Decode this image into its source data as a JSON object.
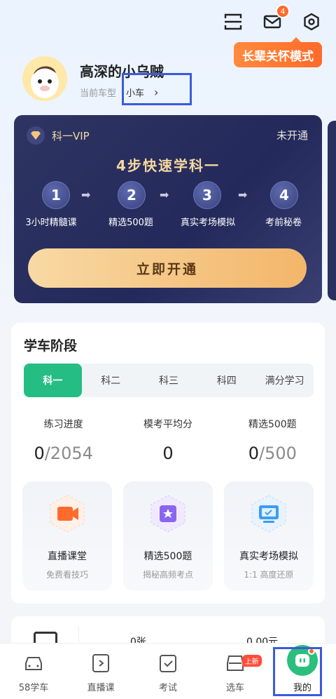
{
  "header": {
    "mail_badge": "4",
    "care_mode_label": "长辈关怀模式"
  },
  "user": {
    "name": "高深的小乌贼",
    "car_label": "当前车型",
    "car_value": "小车"
  },
  "vip": {
    "title": "科一VIP",
    "status": "未开通",
    "heading": "4步快速学科一",
    "steps": [
      {
        "num": "1",
        "label": "3小时精髓课"
      },
      {
        "num": "2",
        "label": "精选500题"
      },
      {
        "num": "3",
        "label": "真实考场模拟"
      },
      {
        "num": "4",
        "label": "考前秘卷"
      }
    ],
    "button": "立即开通"
  },
  "stage": {
    "title": "学车阶段",
    "tabs": [
      "科一",
      "科二",
      "科三",
      "科四",
      "满分学习"
    ],
    "stats": [
      {
        "label": "练习进度",
        "value": "0",
        "total": "/2054"
      },
      {
        "label": "模考平均分",
        "value": "0",
        "total": ""
      },
      {
        "label": "精选500题",
        "value": "0",
        "total": "/500"
      }
    ],
    "tiles": [
      {
        "name": "直播课堂",
        "desc": "免费看技巧"
      },
      {
        "name": "精选500题",
        "desc": "揭秘高频考点"
      },
      {
        "name": "真实考场模拟",
        "desc": "1:1 高度还原"
      }
    ]
  },
  "wallet": {
    "count": "0张",
    "amount": "0.00元"
  },
  "tabbar": {
    "items": [
      {
        "label": "58学车"
      },
      {
        "label": "直播课"
      },
      {
        "label": "考试"
      },
      {
        "label": "选车",
        "badge": "上新"
      },
      {
        "label": "我的"
      }
    ]
  },
  "colors": {
    "accent_green": "#25bd84",
    "vip_bg": "#2e3562",
    "orange": "#ff6a2a",
    "highlight": "#3a5bd8"
  }
}
